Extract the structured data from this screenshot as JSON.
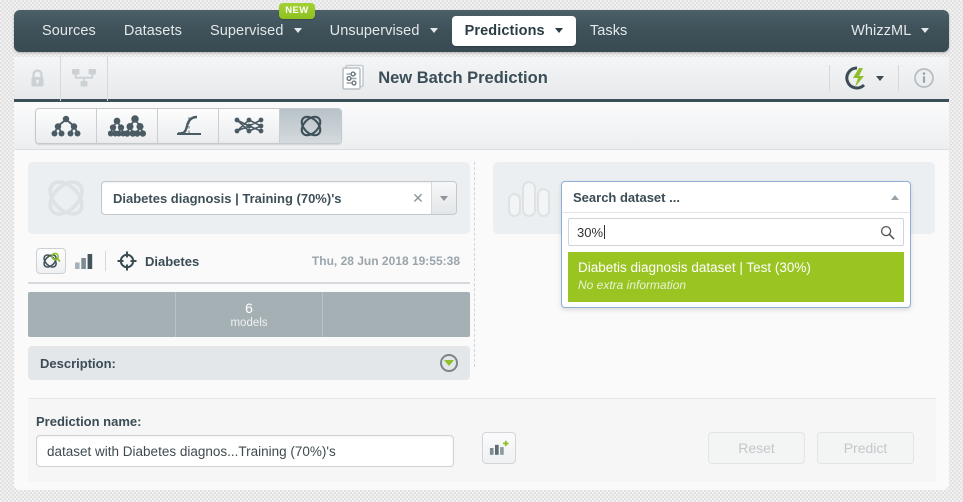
{
  "topnav": {
    "items": [
      {
        "label": "Sources",
        "dropdown": false,
        "active": false,
        "badge": null
      },
      {
        "label": "Datasets",
        "dropdown": false,
        "active": false,
        "badge": null
      },
      {
        "label": "Supervised",
        "dropdown": true,
        "active": false,
        "badge": "NEW"
      },
      {
        "label": "Unsupervised",
        "dropdown": true,
        "active": false,
        "badge": null
      },
      {
        "label": "Predictions",
        "dropdown": true,
        "active": true,
        "badge": null
      },
      {
        "label": "Tasks",
        "dropdown": false,
        "active": false,
        "badge": null
      }
    ],
    "account": {
      "label": "WhizzML",
      "dropdown": true
    }
  },
  "header": {
    "title": "New Batch Prediction",
    "left_icons": [
      "lock-icon",
      "network-icon"
    ],
    "right_icons": [
      "flash-icon",
      "info-icon"
    ]
  },
  "toolbar": {
    "tabs": [
      {
        "name": "model-tab",
        "icon": "decision-tree-icon",
        "selected": false
      },
      {
        "name": "ensemble-tab",
        "icon": "ensemble-icon",
        "selected": false
      },
      {
        "name": "logistic-regression-tab",
        "icon": "logistic-curve-icon",
        "selected": false
      },
      {
        "name": "deepnet-tab",
        "icon": "neural-network-icon",
        "selected": false
      },
      {
        "name": "fusion-tab",
        "icon": "fusion-icon",
        "selected": true
      }
    ]
  },
  "left_panel": {
    "icon": "fusion-icon",
    "selected_resource": "Diabetes diagnosis | Training (70%)'s",
    "clear_symbol": "✕",
    "info": {
      "preview_icon": "fusion-search-icon",
      "chart_icon": "bar-chart-icon",
      "objective_icon": "target-icon",
      "objective_field": "Diabetes",
      "timestamp": "Thu, 28 Jun 2018 19:55:38"
    },
    "stats": [
      {
        "value": "",
        "label": ""
      },
      {
        "value": "6",
        "label": "models"
      },
      {
        "value": "",
        "label": ""
      }
    ],
    "description_label": "Description:"
  },
  "right_panel": {
    "icon": "dataset-bars-icon",
    "dropdown": {
      "header": "Search dataset ...",
      "search_value": "30%",
      "search_icon": "magnifier-icon",
      "collapse_icon": "chevron-up-icon",
      "results": [
        {
          "title": "Diabetis diagnosis dataset | Test (30%)",
          "subtitle": "No extra information",
          "highlighted": true
        }
      ]
    }
  },
  "bottom": {
    "prediction_name_label": "Prediction name:",
    "prediction_name_value": "dataset with Diabetes diagnos...Training (70%)'s",
    "prediction_name_placeholder": "Prediction name",
    "add_chart_icon": "add-chart-icon",
    "reset_label": "Reset",
    "predict_label": "Predict"
  },
  "colors": {
    "nav_bg": "#3e5058",
    "accent_green": "#9ac422",
    "badge_green": "#8dc022",
    "stats_bar": "#a5b0b4",
    "text_dark": "#3b4c55"
  }
}
